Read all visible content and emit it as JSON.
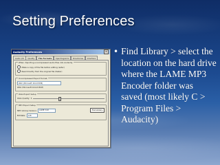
{
  "slide": {
    "title": "Setting Preferences",
    "bullet": "Find Library > select the location on the hard drive where the LAME MP3 Encoder folder was saved (most likely C > Program Files > Audacity)",
    "colors": {
      "background_top": "#0f2d66",
      "background_bottom": "#8ea7cf",
      "text": "#ffffff"
    }
  },
  "dialog": {
    "title": "Audacity Preferences",
    "close_label": "×",
    "tabs": [
      "Audio I/O",
      "Quality",
      "File Formats",
      "Spectrograms",
      "Directories",
      "Interface"
    ],
    "active_tab": "File Formats",
    "uncompressed_group": {
      "label": "When importing uncompressed audio files into Audacity",
      "options": [
        "Make a copy of the file before editing (safer)",
        "Read directly from the original file (faster)"
      ]
    },
    "export_group": {
      "label": "Uncompressed Export Format",
      "format_value": "WAV (Microsoft 16 bit PCM)",
      "subtext": "WAV (Microsoft 16 bit PCM)"
    },
    "ogg_group": {
      "label": "OGG Export Setup",
      "quality_label": "OGG Quality:",
      "quality_value": "5"
    },
    "mp3_group": {
      "label": "MP3 Export Setup",
      "library_label": "MP3 Library Version:",
      "library_value": "LAME 3.93",
      "find_library_label": "Find Library",
      "bitrate_label": "Bit Rate:",
      "bitrate_value": "128"
    }
  }
}
